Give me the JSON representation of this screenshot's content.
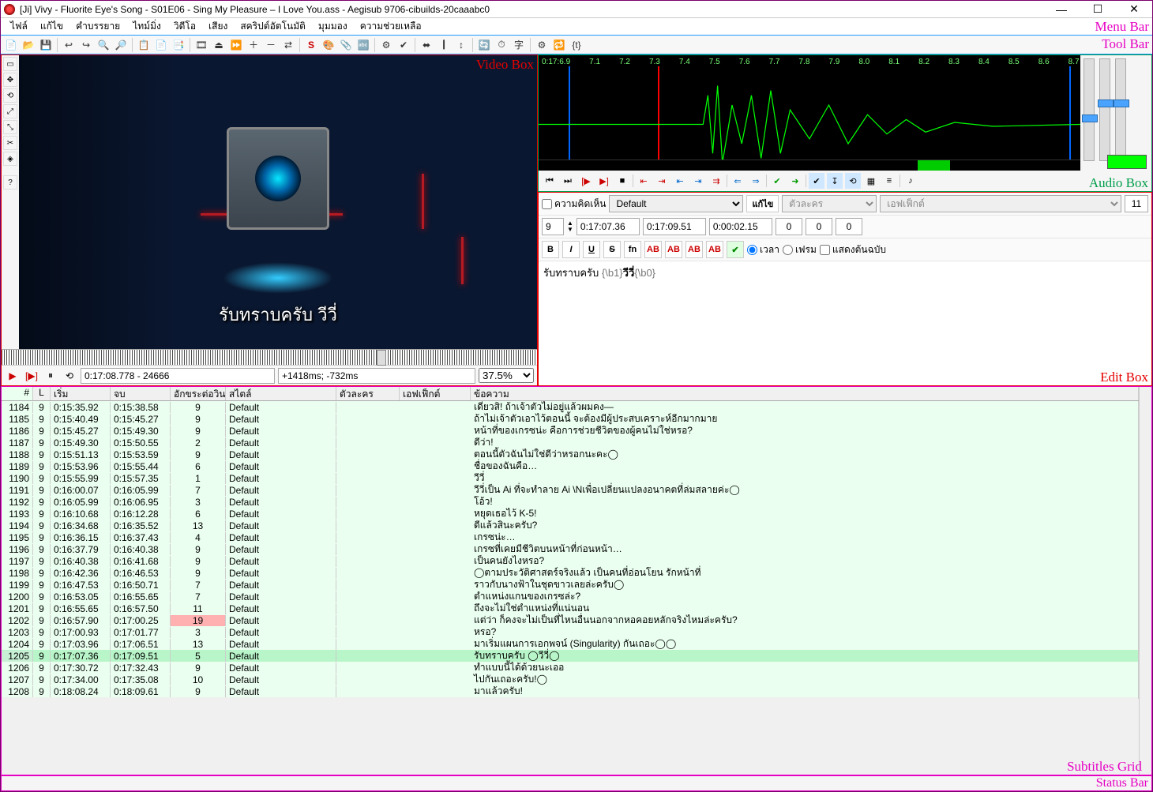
{
  "title": "[Ji] Vivy - Fluorite Eye's Song - S01E06 - Sing My Pleasure – I Love You.ass - Aegisub 9706-cibuilds-20caaabc0",
  "labels": {
    "menubar": "Menu Bar",
    "toolbar": "Tool Bar",
    "video": "Video Box",
    "audio": "Audio Box",
    "edit": "Edit Box",
    "grid": "Subtitles Grid",
    "status": "Status Bar"
  },
  "menu": [
    "ไฟล์",
    "แก้ไข",
    "คำบรรยาย",
    "ไทม์มิ่ง",
    "วิดีโอ",
    "เสียง",
    "สคริปต์อัตโนมัติ",
    "มุมมอง",
    "ความช่วยเหลือ"
  ],
  "video": {
    "subtitle": "รับทราบครับ วีวี่",
    "timepos": "0:17:08.778 - 24666",
    "subdelay": "+1418ms; -732ms",
    "zoom": "37.5%"
  },
  "audio": {
    "ruler": [
      "0:17:6.9",
      "7.1",
      "7.2",
      "7.3",
      "7.4",
      "7.5",
      "7.6",
      "7.7",
      "7.8",
      "7.9",
      "8.0",
      "8.1",
      "8.2",
      "8.3",
      "8.4",
      "8.5",
      "8.6",
      "8.7"
    ]
  },
  "edit": {
    "comment_label": "ความคิดเห็น",
    "style": "Default",
    "styles": [
      "Default"
    ],
    "edit_btn": "แก้ไข",
    "actor_ph": "ตัวละคร",
    "effect_ph": "เอฟเฟ็กต์",
    "margin": "11",
    "layer": "9",
    "start": "0:17:07.36",
    "end": "0:17:09.51",
    "dur": "0:00:02.15",
    "ml": "0",
    "mr": "0",
    "mv": "0",
    "time_label": "เวลา",
    "frame_label": "เฟรม",
    "orig_label": "แสดงต้นฉบับ",
    "text_plain": "รับทราบครับ ",
    "text_tag1": "{\\b1}",
    "text_bold": "วีวี่",
    "text_tag2": "{\\b0}"
  },
  "grid": {
    "headers": {
      "num": "#",
      "l": "L",
      "start": "เริ่ม",
      "end": "จบ",
      "cps": "อักขระต่อวินาที",
      "style": "สไตล์",
      "actor": "ตัวละคร",
      "effect": "เอฟเฟ็กต์",
      "text": "ข้อความ"
    },
    "rows": [
      {
        "n": 1184,
        "l": 9,
        "s": "0:15:35.92",
        "e": "0:15:38.58",
        "c": 9,
        "st": "Default",
        "t": "เดี๋ยวสิ! ถ้าเจ้าตัวไม่อยู่แล้วผมคง—"
      },
      {
        "n": 1185,
        "l": 9,
        "s": "0:15:40.49",
        "e": "0:15:45.27",
        "c": 9,
        "st": "Default",
        "t": "ถ้าไม่เจ้าตัวเอาไว้ตอนนี้ จะต้องมีผู้ประสบเคราะห์อีกมากมาย"
      },
      {
        "n": 1186,
        "l": 9,
        "s": "0:15:45.27",
        "e": "0:15:49.30",
        "c": 9,
        "st": "Default",
        "t": "หน้าที่ของเกรซน่ะ คือการช่วยชีวิตของผู้คนไม่ใช่หรอ?"
      },
      {
        "n": 1187,
        "l": 9,
        "s": "0:15:49.30",
        "e": "0:15:50.55",
        "c": 2,
        "st": "Default",
        "t": "ดีว่า!"
      },
      {
        "n": 1188,
        "l": 9,
        "s": "0:15:51.13",
        "e": "0:15:53.59",
        "c": 9,
        "st": "Default",
        "t": "ตอนนี้ตัวฉันไม่ใช่ดีว่าหรอกนะคะ◯"
      },
      {
        "n": 1189,
        "l": 9,
        "s": "0:15:53.96",
        "e": "0:15:55.44",
        "c": 6,
        "st": "Default",
        "t": "ชื่อของฉันคือ…"
      },
      {
        "n": 1190,
        "l": 9,
        "s": "0:15:55.99",
        "e": "0:15:57.35",
        "c": 1,
        "st": "Default",
        "t": "วีวี่"
      },
      {
        "n": 1191,
        "l": 9,
        "s": "0:16:00.07",
        "e": "0:16:05.99",
        "c": 7,
        "st": "Default",
        "t": "วีวี่เป็น Ai ที่จะทำลาย Ai \\Nเพื่อเปลี่ยนแปลงอนาคตที่ล่มสลายค่ะ◯"
      },
      {
        "n": 1192,
        "l": 9,
        "s": "0:16:05.99",
        "e": "0:16:06.95",
        "c": 3,
        "st": "Default",
        "t": "โอ้ว!"
      },
      {
        "n": 1193,
        "l": 9,
        "s": "0:16:10.68",
        "e": "0:16:12.28",
        "c": 6,
        "st": "Default",
        "t": "หยุดเธอไว้ K-5!"
      },
      {
        "n": 1194,
        "l": 9,
        "s": "0:16:34.68",
        "e": "0:16:35.52",
        "c": 13,
        "st": "Default",
        "t": "ดีแล้วสินะครับ?"
      },
      {
        "n": 1195,
        "l": 9,
        "s": "0:16:36.15",
        "e": "0:16:37.43",
        "c": 4,
        "st": "Default",
        "t": "เกรซน่ะ…"
      },
      {
        "n": 1196,
        "l": 9,
        "s": "0:16:37.79",
        "e": "0:16:40.38",
        "c": 9,
        "st": "Default",
        "t": "เกรซที่เคยมีชีวิตบนหน้าที่ก่อนหน้า…"
      },
      {
        "n": 1197,
        "l": 9,
        "s": "0:16:40.38",
        "e": "0:16:41.68",
        "c": 9,
        "st": "Default",
        "t": "เป็นคนยังไงหรอ?"
      },
      {
        "n": 1198,
        "l": 9,
        "s": "0:16:42.36",
        "e": "0:16:46.53",
        "c": 9,
        "st": "Default",
        "t": "◯ตามประวัติศาสตร์จริงแล้ว เป็นคนที่อ่อนโยน รักหน้าที่"
      },
      {
        "n": 1199,
        "l": 9,
        "s": "0:16:47.53",
        "e": "0:16:50.71",
        "c": 7,
        "st": "Default",
        "t": "ราวกับนางฟ้าในชุดขาวเลยล่ะครับ◯"
      },
      {
        "n": 1200,
        "l": 9,
        "s": "0:16:53.05",
        "e": "0:16:55.65",
        "c": 7,
        "st": "Default",
        "t": "ตำแหน่งแกนของเกรซล่ะ?"
      },
      {
        "n": 1201,
        "l": 9,
        "s": "0:16:55.65",
        "e": "0:16:57.50",
        "c": 11,
        "st": "Default",
        "t": "ถึงจะไม่ใช่ตำแหน่งที่แน่นอน"
      },
      {
        "n": 1202,
        "l": 9,
        "s": "0:16:57.90",
        "e": "0:17:00.25",
        "c": 19,
        "hot": true,
        "st": "Default",
        "t": "แต่ว่า ก็คงจะไม่เป็นที่ไหนอื่นนอกจากหอคอยหลักจริงไหมล่ะครับ?"
      },
      {
        "n": 1203,
        "l": 9,
        "s": "0:17:00.93",
        "e": "0:17:01.77",
        "c": 3,
        "st": "Default",
        "t": "หรอ?"
      },
      {
        "n": 1204,
        "l": 9,
        "s": "0:17:03.96",
        "e": "0:17:06.51",
        "c": 13,
        "st": "Default",
        "t": "มาเริ่มแผนการเอกพจน์ (Singularity) กันเถอะ◯◯"
      },
      {
        "n": 1205,
        "l": 9,
        "s": "0:17:07.36",
        "e": "0:17:09.51",
        "c": 5,
        "st": "Default",
        "sel": true,
        "t": "รับทราบครับ ◯วีวี่◯"
      },
      {
        "n": 1206,
        "l": 9,
        "s": "0:17:30.72",
        "e": "0:17:32.43",
        "c": 9,
        "st": "Default",
        "t": "ทำแบบนี้ได้ด้วยนะเออ"
      },
      {
        "n": 1207,
        "l": 9,
        "s": "0:17:34.00",
        "e": "0:17:35.08",
        "c": 10,
        "st": "Default",
        "t": "ไปกันเถอะครับ!◯"
      },
      {
        "n": 1208,
        "l": 9,
        "s": "0:18:08.24",
        "e": "0:18:09.61",
        "c": 9,
        "st": "Default",
        "t": "มาแล้วครับ!"
      }
    ]
  },
  "chart_data": null
}
